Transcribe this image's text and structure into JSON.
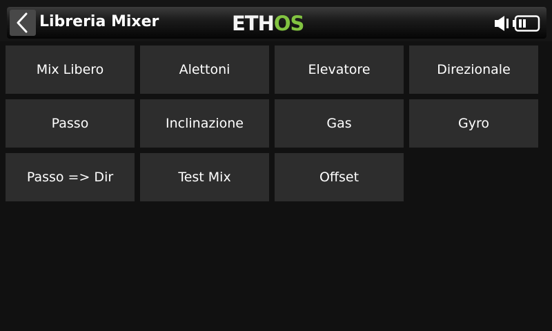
{
  "header": {
    "title": "Libreria Mixer",
    "logo_main": "ETH",
    "logo_accent": "OS",
    "back_icon": "chevron-left-icon",
    "speaker_icon": "speaker-icon",
    "battery_icon": "battery-icon",
    "logo_accent_color": "#82c341"
  },
  "mixers": [
    {
      "label": "Mix Libero"
    },
    {
      "label": "Alettoni"
    },
    {
      "label": "Elevatore"
    },
    {
      "label": "Direzionale"
    },
    {
      "label": "Passo"
    },
    {
      "label": "Inclinazione"
    },
    {
      "label": "Gas"
    },
    {
      "label": "Gyro"
    },
    {
      "label": "Passo => Dir"
    },
    {
      "label": "Test Mix"
    },
    {
      "label": "Offset"
    }
  ]
}
